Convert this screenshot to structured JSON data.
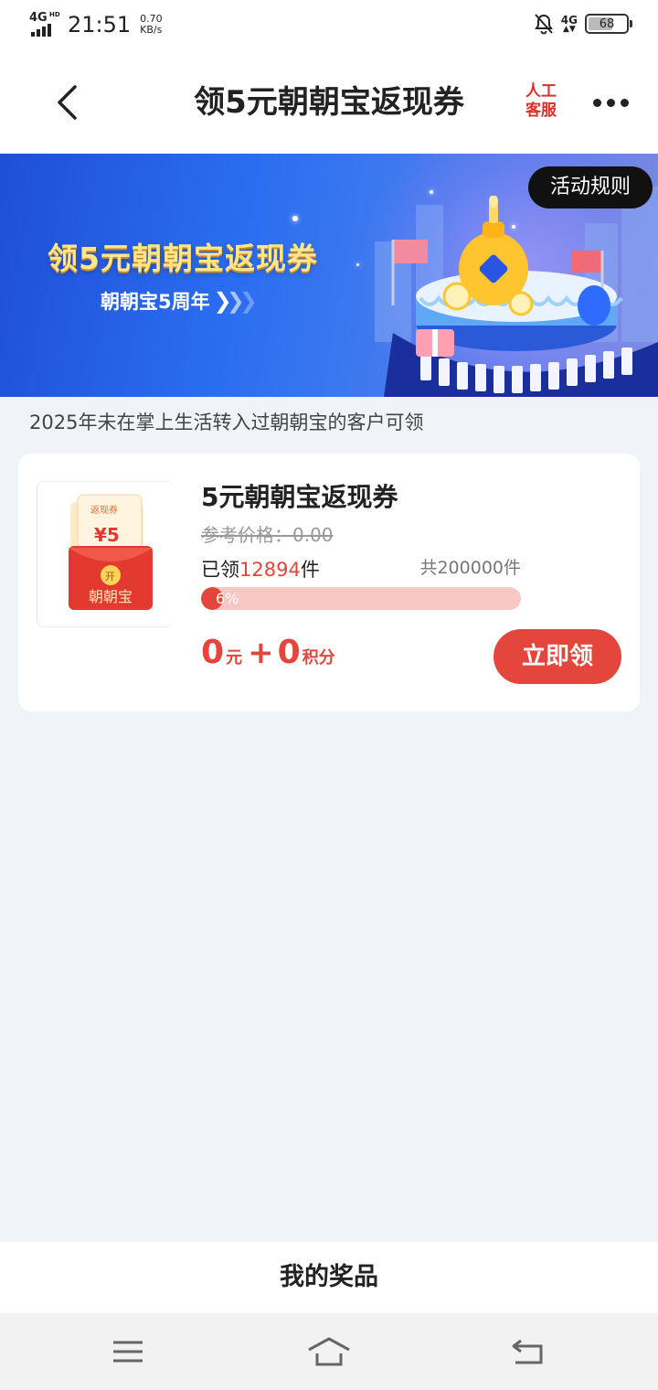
{
  "status_bar": {
    "network": "4G",
    "network_hd": "HD",
    "time": "21:51",
    "speed_value": "0.70",
    "speed_unit": "KB/s",
    "mobile_data": "4G",
    "battery": "68"
  },
  "nav": {
    "title": "领5元朝朝宝返现券",
    "customer_service_line1": "人工",
    "customer_service_line2": "客服"
  },
  "banner": {
    "title": "领5元朝朝宝返现券",
    "subtitle": "朝朝宝5周年",
    "rules_button": "活动规则"
  },
  "eligibility_note": "2025年未在掌上生活转入过朝朝宝的客户可领",
  "product": {
    "thumbnail_badge": "返现券",
    "thumbnail_amount": "¥5",
    "thumbnail_open": "开",
    "thumbnail_brand": "朝朝宝",
    "title": "5元朝朝宝返现券",
    "ref_price": "参考价格：0.00",
    "claimed_prefix": "已领",
    "claimed_count": "12894",
    "claimed_suffix": "件",
    "total": "共200000件",
    "progress_label": "6%",
    "progress_fraction": 0.06,
    "price_cash": "0",
    "price_cash_unit": "元",
    "price_plus": "+",
    "price_points": "0",
    "price_points_unit": "积分",
    "claim_button": "立即领"
  },
  "my_prizes": "我的奖品",
  "colors": {
    "accent": "#e4463c",
    "progress_track": "#f6c7c3",
    "banner_blue": "#2a6cf0",
    "page_bg": "#f0f3f7"
  }
}
